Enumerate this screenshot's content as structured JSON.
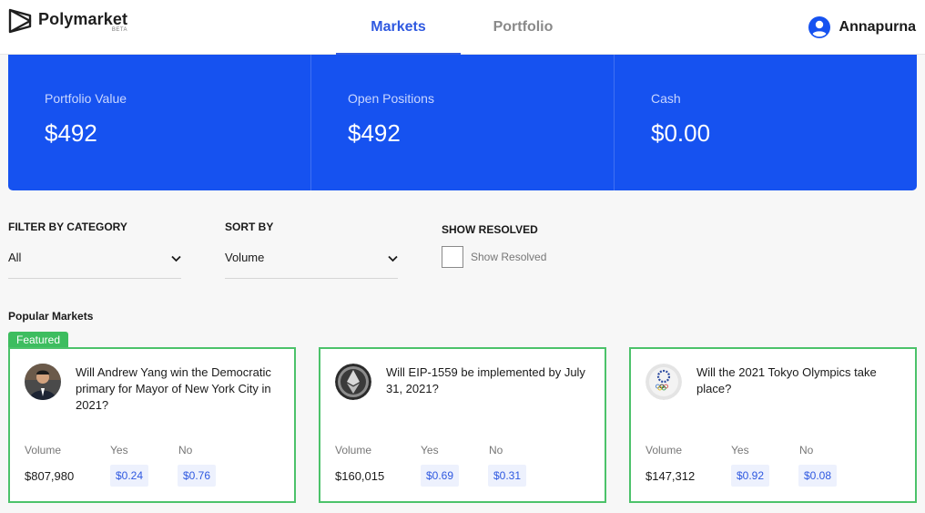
{
  "brand": {
    "name": "Polymarket",
    "tag": "BETA"
  },
  "nav": {
    "tabs": [
      {
        "label": "Markets",
        "active": true
      },
      {
        "label": "Portfolio",
        "active": false
      }
    ]
  },
  "user": {
    "name": "Annapurna",
    "icon": "user-circle-icon"
  },
  "stats": [
    {
      "label": "Portfolio Value",
      "value": "$492"
    },
    {
      "label": "Open Positions",
      "value": "$492"
    },
    {
      "label": "Cash",
      "value": "$0.00"
    }
  ],
  "filters": {
    "category": {
      "title": "FILTER BY CATEGORY",
      "value": "All"
    },
    "sort": {
      "title": "SORT BY",
      "value": "Volume"
    },
    "resolved": {
      "title": "SHOW RESOLVED",
      "label": "Show Resolved",
      "checked": false
    }
  },
  "popular": {
    "title": "Popular Markets",
    "featured_label": "Featured",
    "columns": {
      "volume": "Volume",
      "yes": "Yes",
      "no": "No"
    },
    "markets": [
      {
        "question": "Will Andrew Yang win the Democratic primary for Mayor of New York City in 2021?",
        "volume": "$807,980",
        "yes": "$0.24",
        "no": "$0.76",
        "image": "andrew-yang-photo"
      },
      {
        "question": "Will EIP-1559 be implemented by July 31, 2021?",
        "volume": "$160,015",
        "yes": "$0.69",
        "no": "$0.31",
        "image": "ethereum-coin-image"
      },
      {
        "question": "Will the 2021 Tokyo Olympics take place?",
        "volume": "$147,312",
        "yes": "$0.92",
        "no": "$0.08",
        "image": "tokyo-olympics-emblem"
      }
    ]
  },
  "colors": {
    "brand_blue": "#1652f0",
    "accent_blue": "#2f59e0",
    "featured_green": "#3dbd5f",
    "card_border": "#4cc26a"
  }
}
